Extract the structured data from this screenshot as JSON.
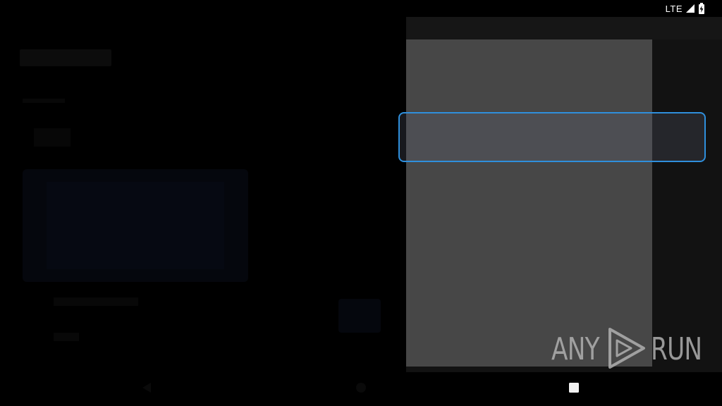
{
  "status_bar": {
    "network_label": "LTE",
    "icons": [
      "signal-icon",
      "battery-charging-icon"
    ]
  },
  "watermark": {
    "left_text": "ANY",
    "right_text": "RUN",
    "logo_icon": "play-triangle-icon"
  },
  "navigation": {
    "buttons": [
      "back-icon",
      "home-icon",
      "recents-icon"
    ]
  },
  "colors": {
    "focus_border": "#2f8fdc",
    "panel_bg": "#474747",
    "panel_frame": "#121212",
    "watermark": "#b0b0b0"
  }
}
